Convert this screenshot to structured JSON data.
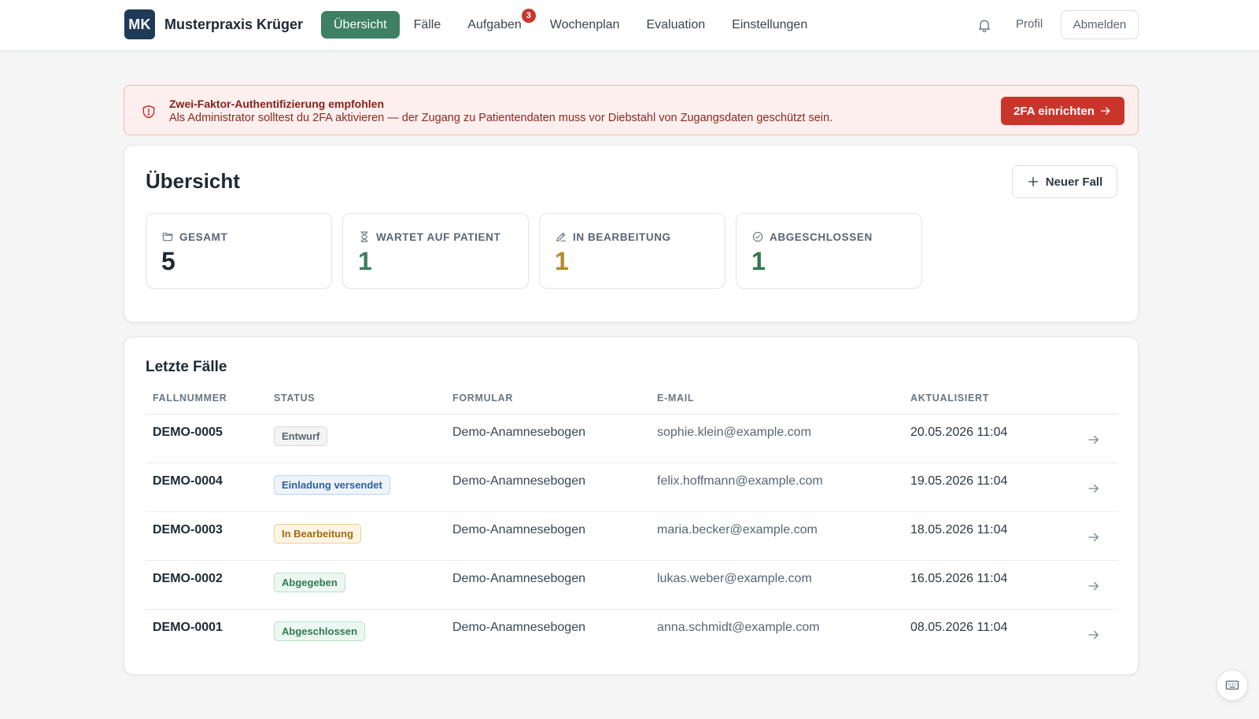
{
  "header": {
    "logo_initials": "MK",
    "brand": "Musterpraxis Krüger",
    "nav": [
      {
        "label": "Übersicht",
        "active": true
      },
      {
        "label": "Fälle"
      },
      {
        "label": "Aufgaben",
        "badge": "3"
      },
      {
        "label": "Wochenplan"
      },
      {
        "label": "Evaluation"
      },
      {
        "label": "Einstellungen"
      }
    ],
    "profile_label": "Profil",
    "logout_label": "Abmelden"
  },
  "alert": {
    "title": "Zwei-Faktor-Authentifizierung empfohlen",
    "text": "Als Administrator solltest du 2FA aktivieren — der Zugang zu Patientendaten muss vor Diebstahl von Zugangsdaten geschützt sein.",
    "button_label": "2FA einrichten"
  },
  "overview": {
    "title": "Übersicht",
    "new_case_label": "Neuer Fall",
    "stats": [
      {
        "label": "Gesamt",
        "value": "5",
        "color": "#1f2933",
        "icon": "folder-icon"
      },
      {
        "label": "Wartet auf Patient",
        "value": "1",
        "color": "#3d8063",
        "icon": "hourglass-icon"
      },
      {
        "label": "In Bearbeitung",
        "value": "1",
        "color": "#b88a2a",
        "icon": "pencil-icon"
      },
      {
        "label": "Abgeschlossen",
        "value": "1",
        "color": "#2f7a52",
        "icon": "check-circle-icon"
      }
    ]
  },
  "cases": {
    "title": "Letzte Fälle",
    "columns": [
      "Fallnummer",
      "Status",
      "Formular",
      "E-Mail",
      "Aktualisiert"
    ],
    "rows": [
      {
        "number": "DEMO-0005",
        "status": "Entwurf",
        "status_kind": "draft",
        "form": "Demo-Anamnesebogen",
        "email": "sophie.klein@example.com",
        "updated": "20.05.2026 11:04"
      },
      {
        "number": "DEMO-0004",
        "status": "Einladung versendet",
        "status_kind": "invited",
        "form": "Demo-Anamnesebogen",
        "email": "felix.hoffmann@example.com",
        "updated": "19.05.2026 11:04"
      },
      {
        "number": "DEMO-0003",
        "status": "In Bearbeitung",
        "status_kind": "progress",
        "form": "Demo-Anamnesebogen",
        "email": "maria.becker@example.com",
        "updated": "18.05.2026 11:04"
      },
      {
        "number": "DEMO-0002",
        "status": "Abgegeben",
        "status_kind": "submitted",
        "form": "Demo-Anamnesebogen",
        "email": "lukas.weber@example.com",
        "updated": "16.05.2026 11:04"
      },
      {
        "number": "DEMO-0001",
        "status": "Abgeschlossen",
        "status_kind": "closed",
        "form": "Demo-Anamnesebogen",
        "email": "anna.schmidt@example.com",
        "updated": "08.05.2026 11:04"
      }
    ]
  },
  "colors": {
    "accent": "#3d8063",
    "danger": "#c9352b",
    "status_draft": "#5a6570",
    "status_invited": "#2f5f9e",
    "status_progress": "#a46a12",
    "status_submitted": "#2f7a52",
    "status_closed": "#2f7a52"
  }
}
